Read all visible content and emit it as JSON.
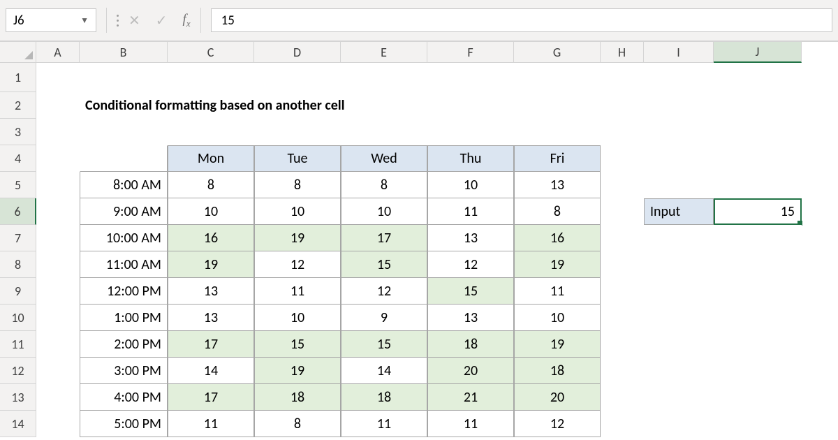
{
  "formula_bar": {
    "name_box": "J6",
    "value": "15"
  },
  "columns": [
    "A",
    "B",
    "C",
    "D",
    "E",
    "F",
    "G",
    "H",
    "I",
    "J"
  ],
  "active_col": "J",
  "active_row": 6,
  "title": "Conditional formatting based on another cell",
  "table": {
    "headers": [
      "Mon",
      "Tue",
      "Wed",
      "Thu",
      "Fri"
    ],
    "rows": [
      {
        "time": "8:00 AM",
        "v": [
          8,
          8,
          8,
          10,
          13
        ]
      },
      {
        "time": "9:00 AM",
        "v": [
          10,
          10,
          10,
          11,
          8
        ]
      },
      {
        "time": "10:00 AM",
        "v": [
          16,
          19,
          17,
          13,
          16
        ]
      },
      {
        "time": "11:00 AM",
        "v": [
          19,
          12,
          15,
          12,
          19
        ]
      },
      {
        "time": "12:00 PM",
        "v": [
          13,
          11,
          12,
          15,
          11
        ]
      },
      {
        "time": "1:00 PM",
        "v": [
          13,
          10,
          9,
          13,
          10
        ]
      },
      {
        "time": "2:00 PM",
        "v": [
          17,
          15,
          15,
          18,
          19
        ]
      },
      {
        "time": "3:00 PM",
        "v": [
          14,
          19,
          14,
          20,
          18
        ]
      },
      {
        "time": "4:00 PM",
        "v": [
          17,
          18,
          18,
          21,
          20
        ]
      },
      {
        "time": "5:00 PM",
        "v": [
          11,
          8,
          11,
          11,
          12
        ]
      }
    ]
  },
  "input": {
    "label": "Input",
    "value": 15
  },
  "chart_data": {
    "type": "table",
    "title": "Conditional formatting based on another cell",
    "categories": [
      "Mon",
      "Tue",
      "Wed",
      "Thu",
      "Fri"
    ],
    "x": [
      "8:00 AM",
      "9:00 AM",
      "10:00 AM",
      "11:00 AM",
      "12:00 PM",
      "1:00 PM",
      "2:00 PM",
      "3:00 PM",
      "4:00 PM",
      "5:00 PM"
    ],
    "series": [
      {
        "name": "Mon",
        "values": [
          8,
          10,
          16,
          19,
          13,
          13,
          17,
          14,
          17,
          11
        ]
      },
      {
        "name": "Tue",
        "values": [
          8,
          10,
          19,
          12,
          11,
          10,
          15,
          19,
          18,
          8
        ]
      },
      {
        "name": "Wed",
        "values": [
          8,
          10,
          17,
          15,
          12,
          9,
          15,
          14,
          18,
          11
        ]
      },
      {
        "name": "Thu",
        "values": [
          10,
          11,
          13,
          12,
          15,
          13,
          18,
          20,
          21,
          11
        ]
      },
      {
        "name": "Fri",
        "values": [
          13,
          8,
          16,
          19,
          11,
          10,
          19,
          18,
          20,
          12
        ]
      }
    ],
    "highlight_threshold": 15,
    "highlight_rule": ">="
  }
}
